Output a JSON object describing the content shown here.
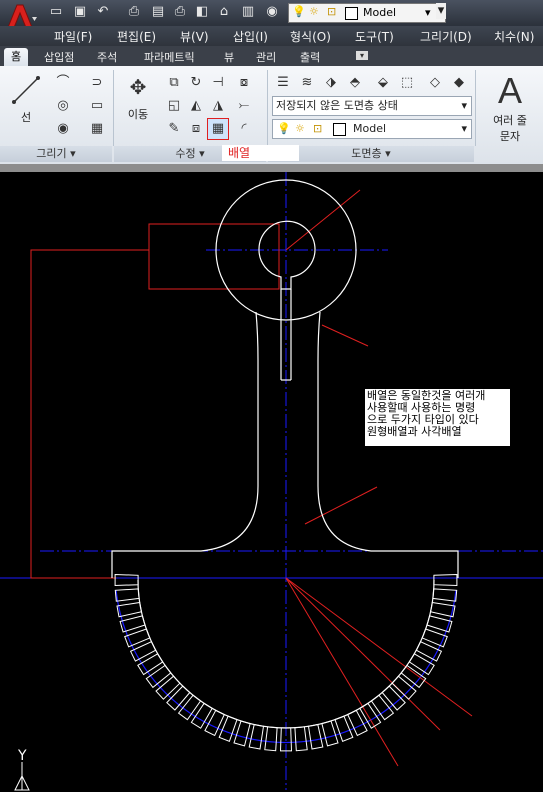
{
  "qat": {
    "layer_name": "Model"
  },
  "menu": {
    "items": [
      "파일(F)",
      "편집(E)",
      "뷰(V)",
      "삽입(I)",
      "형식(O)",
      "도구(T)",
      "그리기(D)",
      "치수(N)"
    ]
  },
  "ribbon_tabs": [
    "홈",
    "삽입점",
    "주석",
    "파라메트릭",
    "뷰",
    "관리",
    "출력"
  ],
  "panels": {
    "draw": {
      "title": "그리기",
      "line_label": "선"
    },
    "modify": {
      "title": "수정",
      "move_label": "이동",
      "tooltip": "배열"
    },
    "layers": {
      "title": "도면층",
      "state": "저장되지 않은 도면층 상태",
      "current": "Model"
    },
    "annotation": {
      "text_label": "여러 줄",
      "text_label2": "문자"
    }
  },
  "note": {
    "lines": [
      "배열은 동일한것을 여러개",
      "사용할때 사용하는 명령",
      "으로 두가지 타입이 있다",
      "원형배열과 사각배열"
    ]
  },
  "ucs": {
    "y_label": "Y"
  },
  "colors": {
    "drawing_line": "#ffffff",
    "centerline": "#1a1aff",
    "callout": "#e02020",
    "background": "#000000"
  }
}
